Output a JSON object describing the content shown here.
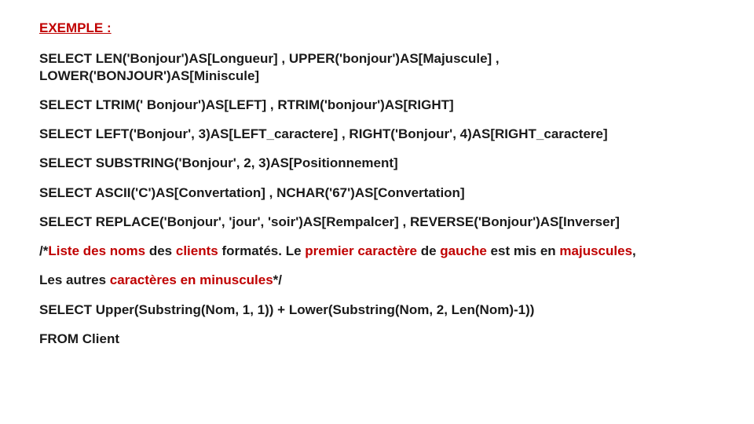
{
  "title": "EXEMPLE :",
  "lines": {
    "s1a": "SELECT LEN('Bonjour')AS[Longueur] , UPPER('bonjour')AS[Majuscule] ,",
    "s1b": "LOWER('BONJOUR')AS[Miniscule]",
    "s2": "SELECT LTRIM('    Bonjour')AS[LEFT] , RTRIM('bonjour')AS[RIGHT]",
    "s3": "SELECT LEFT('Bonjour', 3)AS[LEFT_caractere] , RIGHT('Bonjour', 4)AS[RIGHT_caractere]",
    "s4": "SELECT SUBSTRING('Bonjour', 2, 3)AS[Positionnement]",
    "s5": "SELECT ASCII('C')AS[Convertation] , NCHAR('67')AS[Convertation]",
    "s6": "SELECT REPLACE('Bonjour', 'jour', 'soir')AS[Rempalcer] , REVERSE('Bonjour')AS[Inverser]",
    "s7": "SELECT Upper(Substring(Nom, 1, 1)) + Lower(Substring(Nom, 2, Len(Nom)-1))",
    "s8": "FROM Client"
  },
  "comment1": {
    "t1": "/*",
    "r1": "Liste des noms",
    "t2": " des ",
    "r2": "clients",
    "t3": " formatés. Le ",
    "r3": "premier caractère",
    "t4": " de ",
    "r4": "gauche",
    "t5": " est mis en ",
    "r5": "majuscules",
    "t6": ","
  },
  "comment2": {
    "t1": "Les autres ",
    "r1": "caractères en minuscules",
    "t2": "*/"
  }
}
